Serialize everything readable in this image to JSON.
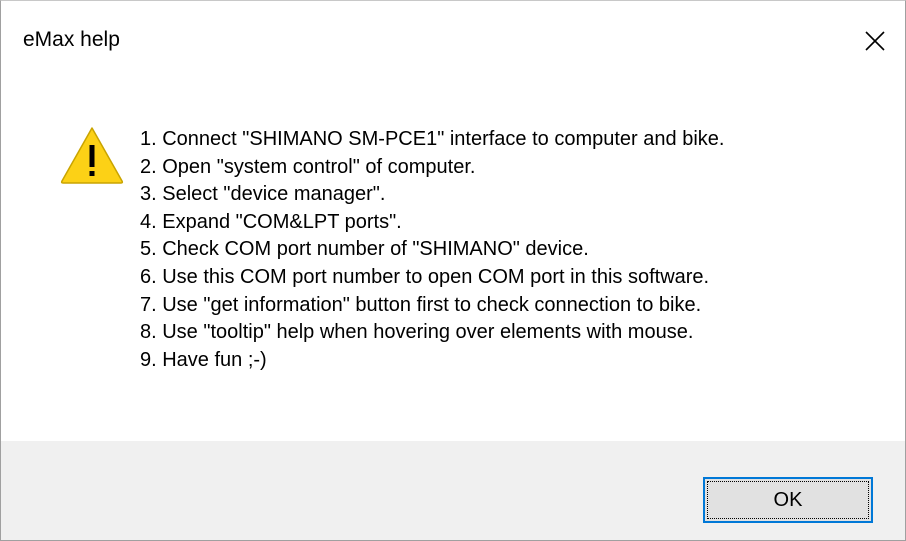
{
  "window": {
    "title": "eMax help",
    "close_icon": "close-icon"
  },
  "message": {
    "icon": "warning-icon",
    "lines": [
      "1. Connect \"SHIMANO SM-PCE1\" interface to computer and bike.",
      "2. Open \"system control\" of computer.",
      "3. Select \"device manager\".",
      "4. Expand \"COM&LPT ports\".",
      "5. Check COM port number of \"SHIMANO\" device.",
      "6. Use this COM port number to open COM port in this software.",
      "7. Use \"get information\" button first to check connection to bike.",
      "8. Use \"tooltip\" help when hovering over elements with mouse.",
      "9. Have fun ;-)"
    ]
  },
  "buttons": {
    "ok_label": "OK"
  },
  "colors": {
    "warning_fill": "#fcd116",
    "focus_border": "#0078d7",
    "footer_bg": "#f0f0f0",
    "button_bg": "#e1e1e1"
  }
}
